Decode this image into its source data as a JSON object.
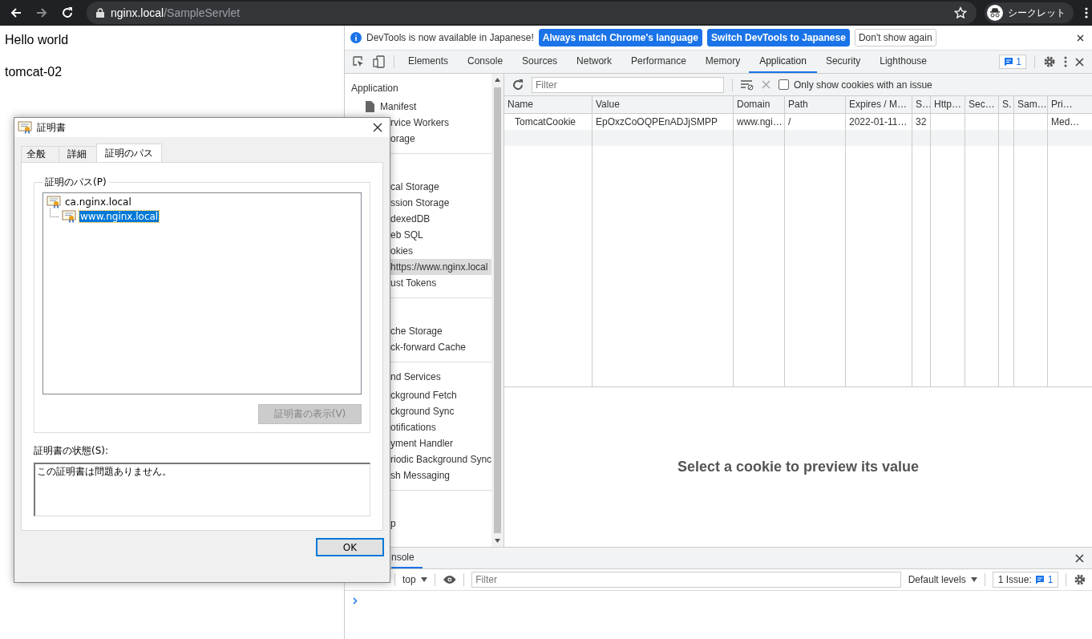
{
  "browser": {
    "address_host": "nginx.local",
    "address_path": "/SampleServlet",
    "incognito_label": "シークレット"
  },
  "page": {
    "lines": [
      "Hello world",
      "tomcat-02"
    ]
  },
  "devtools": {
    "infobar": {
      "message": "DevTools is now available in Japanese!",
      "buttons": [
        {
          "label": "Always match Chrome's language",
          "kind": "primary"
        },
        {
          "label": "Switch DevTools to Japanese",
          "kind": "primary"
        },
        {
          "label": "Don't show again",
          "kind": "plain"
        }
      ]
    },
    "tabs": [
      {
        "label": "Elements",
        "selected": false
      },
      {
        "label": "Console",
        "selected": false
      },
      {
        "label": "Sources",
        "selected": false
      },
      {
        "label": "Network",
        "selected": false
      },
      {
        "label": "Performance",
        "selected": false
      },
      {
        "label": "Memory",
        "selected": false
      },
      {
        "label": "Application",
        "selected": true
      },
      {
        "label": "Security",
        "selected": false
      },
      {
        "label": "Lighthouse",
        "selected": false
      }
    ],
    "issues_count": "1",
    "sidebar": {
      "sections": [
        {
          "header": "Application",
          "items": [
            {
              "label": "Manifest",
              "kind": "file",
              "selected": false
            },
            {
              "label": "rvice Workers",
              "kind": "clipped",
              "selected": false
            },
            {
              "label": "orage",
              "kind": "clipped",
              "selected": false
            }
          ]
        },
        {
          "items": [
            {
              "label": "cal Storage",
              "kind": "clipped",
              "selected": false
            },
            {
              "label": "ssion Storage",
              "kind": "clipped",
              "selected": false
            },
            {
              "label": "dexedDB",
              "kind": "clipped",
              "selected": false
            },
            {
              "label": "eb SQL",
              "kind": "clipped",
              "selected": false
            },
            {
              "label": "okies",
              "kind": "clipped",
              "selected": false
            },
            {
              "label": "https://www.nginx.local",
              "kind": "clipped",
              "selected": true
            },
            {
              "label": "ust Tokens",
              "kind": "clipped",
              "selected": false
            }
          ]
        },
        {
          "items": [
            {
              "label": "che Storage",
              "kind": "clipped",
              "selected": false
            },
            {
              "label": "ck-forward Cache",
              "kind": "clipped",
              "selected": false
            }
          ]
        },
        {
          "header": "nd Services",
          "items": [
            {
              "label": "ckground Fetch",
              "kind": "clipped",
              "selected": false
            },
            {
              "label": "ckground Sync",
              "kind": "clipped",
              "selected": false
            },
            {
              "label": "otifications",
              "kind": "clipped",
              "selected": false
            },
            {
              "label": "yment Handler",
              "kind": "clipped",
              "selected": false
            },
            {
              "label": "riodic Background Sync",
              "kind": "clipped",
              "selected": false
            },
            {
              "label": "sh Messaging",
              "kind": "clipped",
              "selected": false
            }
          ]
        },
        {
          "items": [
            {
              "label": "p",
              "kind": "clipped",
              "selected": false
            }
          ]
        }
      ]
    },
    "cookies": {
      "filter_placeholder": "Filter",
      "issue_only": {
        "label": "Only show cookies with an issue",
        "checked": false
      },
      "columns": [
        "Name",
        "Value",
        "Domain",
        "Path",
        "Expires / M…",
        "S…",
        "Http…",
        "Sec…",
        "S.",
        "Sam…",
        "Pri…"
      ],
      "rows": [
        {
          "cells": [
            "TomcatCookie",
            "EpOxzCoOQPEnADJjSMPP",
            "www.ngi…",
            "/",
            "2022-01-11…",
            "32",
            "",
            "",
            "",
            "",
            "Med…"
          ],
          "selected": false
        }
      ],
      "preview_message": "Select a cookie to preview its value"
    },
    "drawer": {
      "tab": {
        "label": "nsole",
        "selected": true
      },
      "context": "top",
      "filter_placeholder": "Filter",
      "levels": "Default levels",
      "issues_label": "1 Issue:",
      "issues_count": "1"
    }
  },
  "dialog": {
    "title": "証明書",
    "tabs": [
      {
        "label": "全般",
        "selected": false
      },
      {
        "label": "詳細",
        "selected": false
      },
      {
        "label": "証明のパス",
        "selected": true
      }
    ],
    "group_label": "証明のパス(P)",
    "tree": [
      {
        "label": "ca.nginx.local",
        "selected": false,
        "children": [
          {
            "label": "www.nginx.local",
            "selected": true
          }
        ]
      }
    ],
    "view_button": {
      "label": "証明書の表示(V)",
      "disabled": true
    },
    "status_label": "証明書の状態(S):",
    "status_text": "この証明書は問題ありません。",
    "ok_button": "OK"
  }
}
